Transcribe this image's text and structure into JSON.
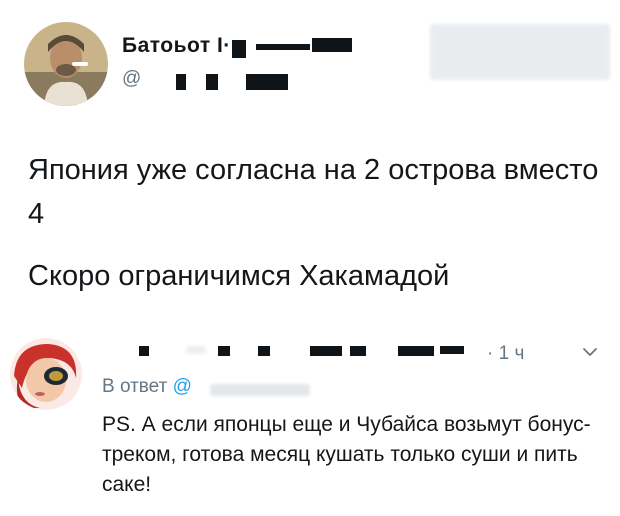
{
  "tweet": {
    "author_name": "Батоьот I·",
    "author_handle": "@",
    "lines": [
      "Япония уже согласна на 2 острова вместо 4",
      "Скоро ограничимся Хакамадой"
    ]
  },
  "reply": {
    "time": "· 1 ч",
    "reply_prefix": "В ответ",
    "reply_handle": "@",
    "text": "PS. А если японцы еще и Чубайса возьмут бонус-треком, готова месяц кушать только суши и пить саке!"
  },
  "icons": {
    "chevron": "chevron-down-icon"
  },
  "colors": {
    "text": "#14171a",
    "secondary": "#657786",
    "accent": "#1da1f2",
    "background": "#ffffff"
  }
}
